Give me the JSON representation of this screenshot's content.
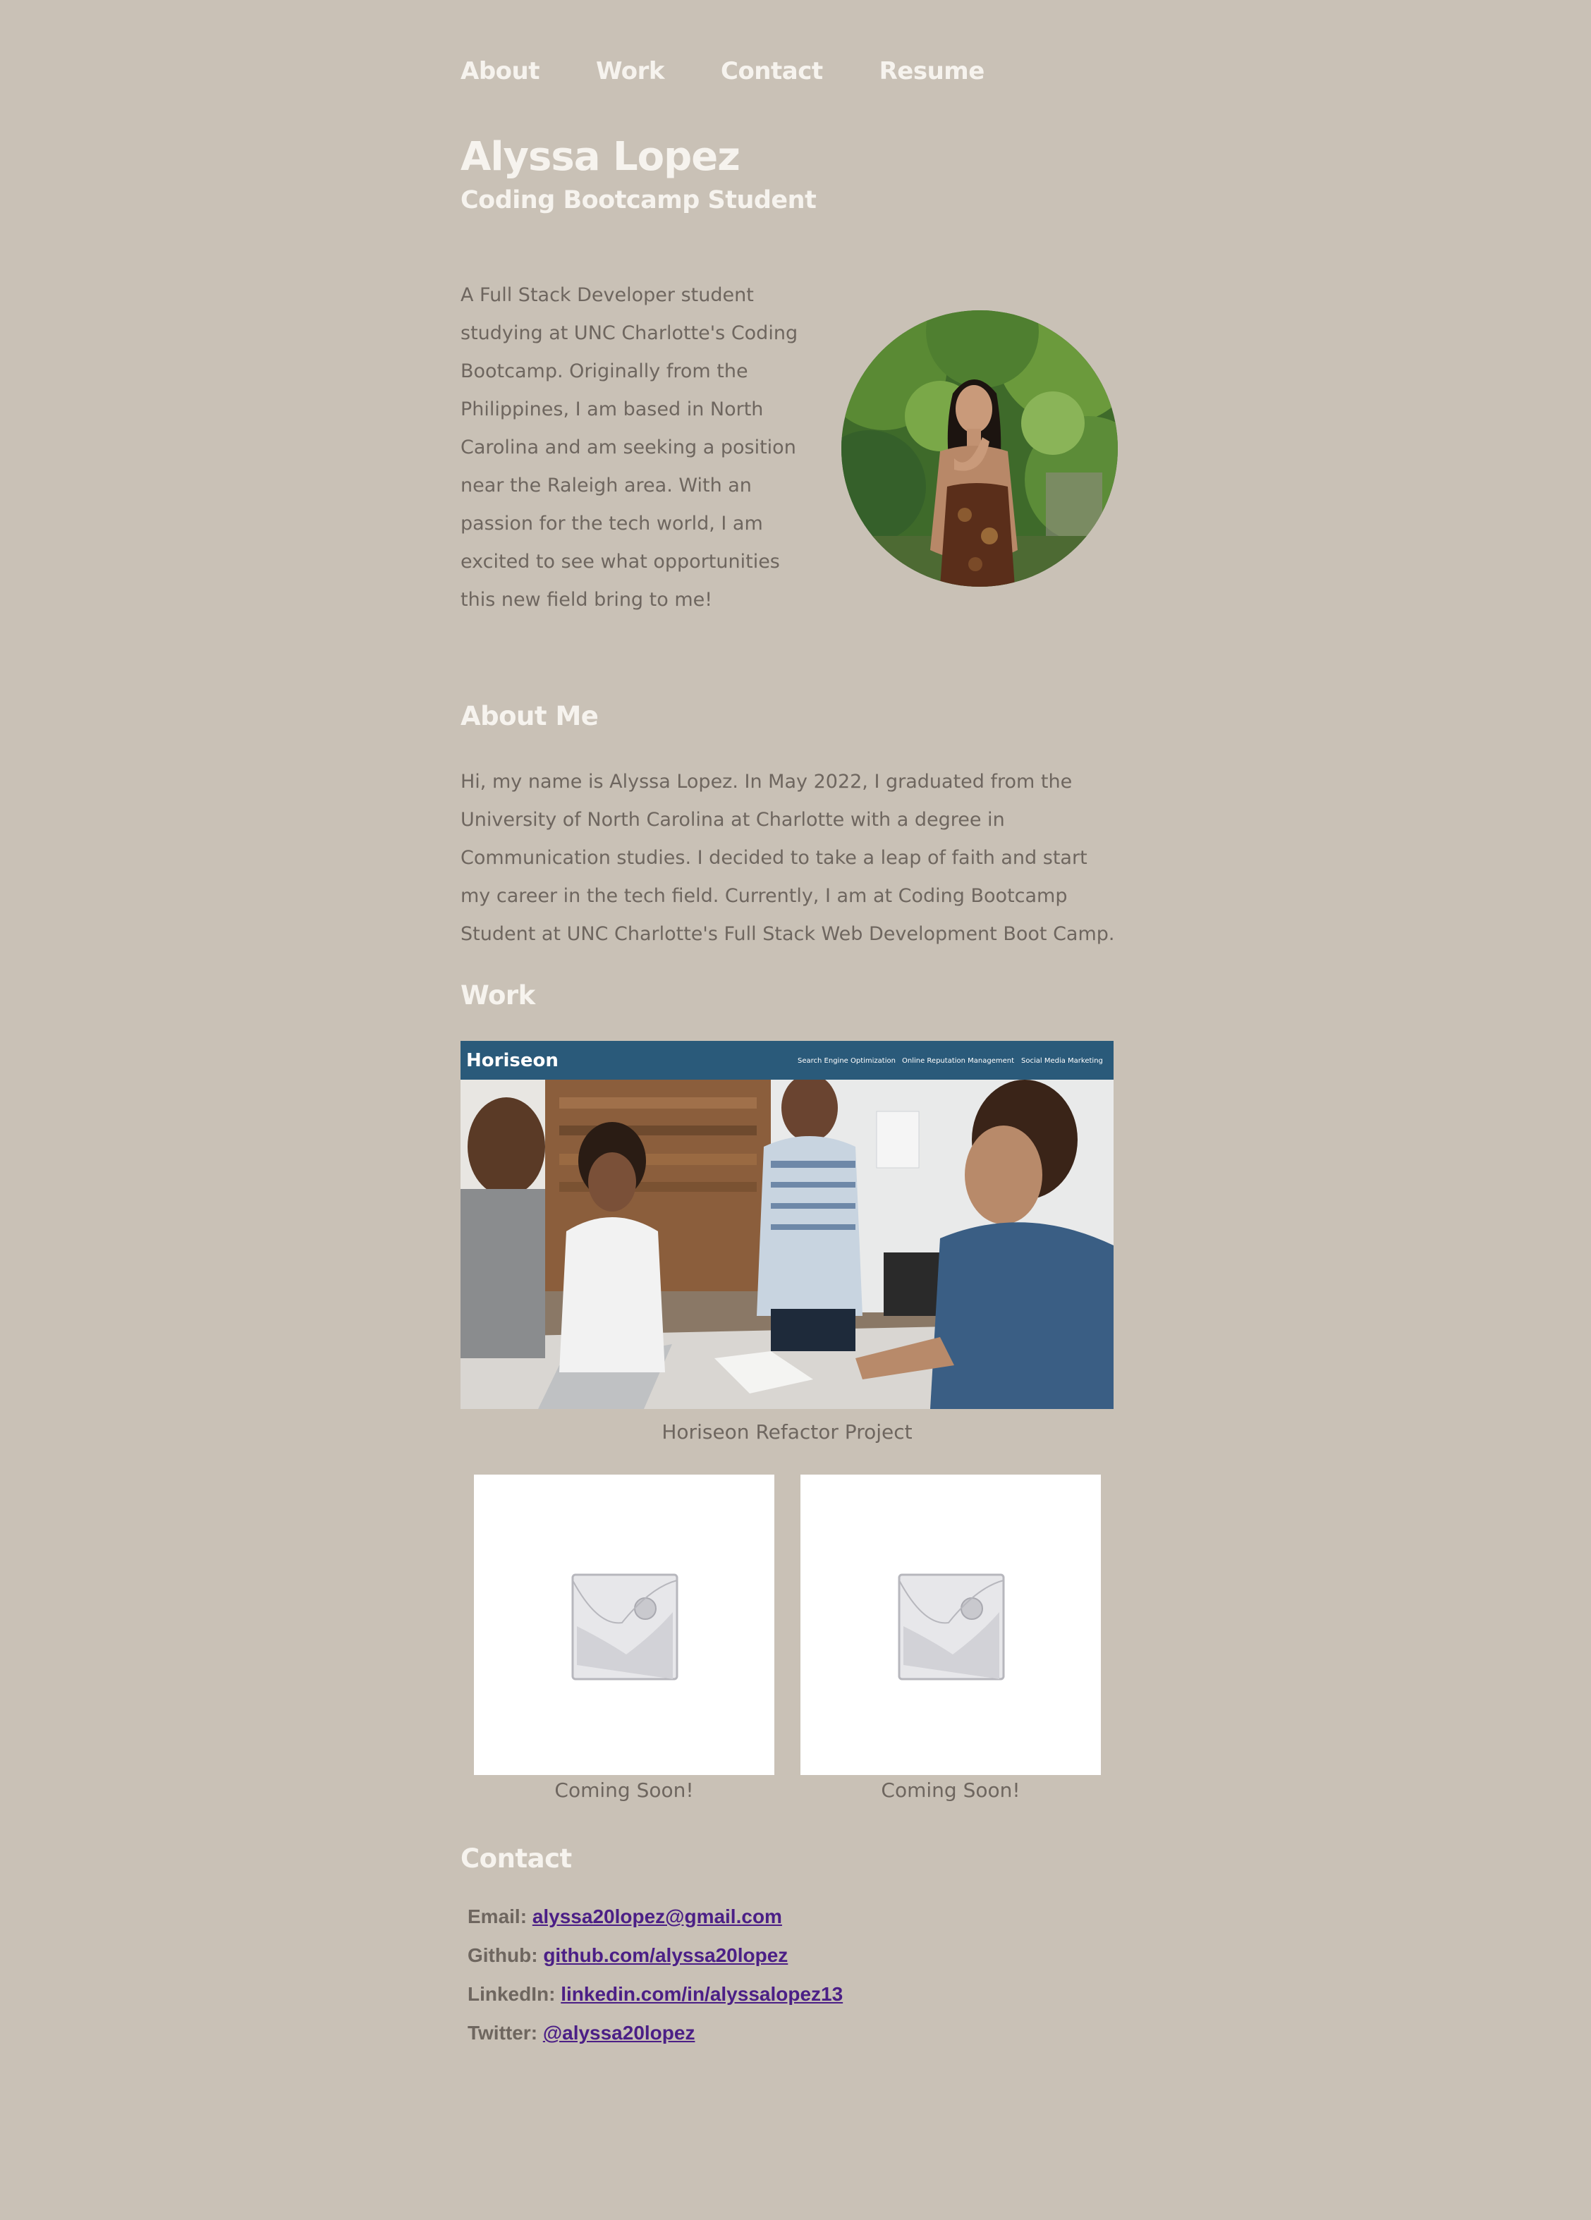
{
  "nav": {
    "items": [
      {
        "label": "About"
      },
      {
        "label": "Work"
      },
      {
        "label": "Contact"
      },
      {
        "label": "Resume"
      }
    ]
  },
  "hero": {
    "name": "Alyssa Lopez",
    "title": "Coding Bootcamp Student",
    "intro": "A Full Stack Developer student studying at UNC Charlotte's Coding Bootcamp. Originally from the Philippines, I am based in North Carolina and am seeking a position near the Raleigh area. With an passion for the tech world, I am excited to see what opportunities this new field bring to me!"
  },
  "about": {
    "heading": "About Me",
    "text": "Hi, my name is Alyssa Lopez. In May 2022, I graduated from the University of North Carolina at Charlotte with a degree in Communication studies. I decided to take a leap of faith and start my career in the tech field. Currently, I am at Coding Bootcamp Student at UNC Charlotte's Full Stack Web Development Boot Camp."
  },
  "work": {
    "heading": "Work",
    "featured": {
      "screenshot_brand": "Horiseon",
      "screenshot_nav": [
        "Search Engine Optimization",
        "Online Reputation Management",
        "Social Media Marketing"
      ],
      "caption": "Horiseon Refactor Project"
    },
    "projects": [
      {
        "caption": "Coming Soon!"
      },
      {
        "caption": "Coming Soon!"
      }
    ]
  },
  "contact": {
    "heading": "Contact",
    "items": [
      {
        "label": "Email:",
        "link": "alyssa20lopez@gmail.com"
      },
      {
        "label": "Github:",
        "link": "github.com/alyssa20lopez"
      },
      {
        "label": "LinkedIn:",
        "link": "linkedin.com/in/alyssalopez13"
      },
      {
        "label": "Twitter:",
        "link": "@alyssa20lopez"
      }
    ]
  },
  "colors": {
    "background": "#c9c1b6",
    "heading": "#f6f3ee",
    "body_text": "#6e665f",
    "link": "#4b1f86",
    "horiseon_header": "#2a5a7a"
  }
}
